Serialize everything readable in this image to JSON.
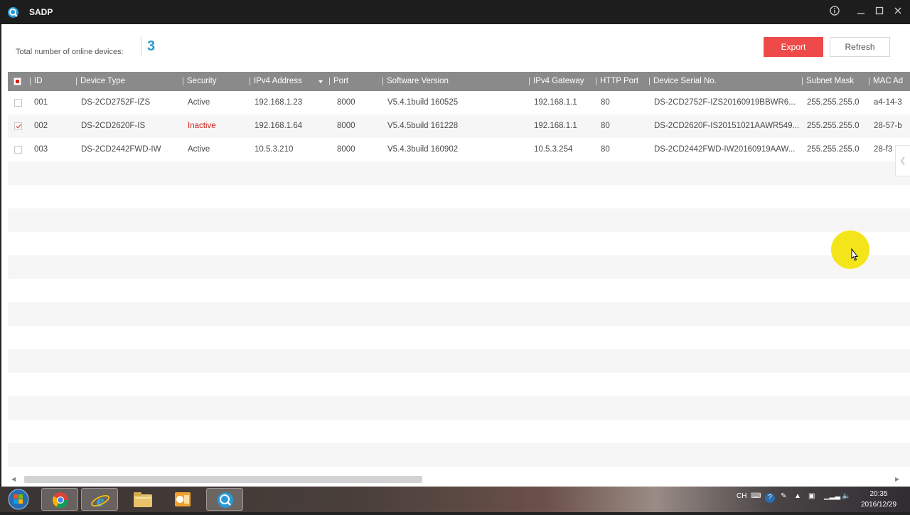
{
  "window": {
    "title": "SADP"
  },
  "summary": {
    "label": "Total number of online devices:",
    "count": "3"
  },
  "buttons": {
    "export": "Export",
    "refresh": "Refresh"
  },
  "columns": {
    "id": "ID",
    "device_type": "Device Type",
    "security": "Security",
    "ipv4_address": "IPv4 Address",
    "port": "Port",
    "software_version": "Software Version",
    "ipv4_gateway": "IPv4 Gateway",
    "http_port": "HTTP Port",
    "serial": "Device Serial No.",
    "subnet_mask": "Subnet Mask",
    "mac": "MAC Ad"
  },
  "rows": [
    {
      "checked": false,
      "id": "001",
      "device_type": "DS-2CD2752F-IZS",
      "security": "Active",
      "ipv4_address": "192.168.1.23",
      "port": "8000",
      "software_version": "V5.4.1build 160525",
      "ipv4_gateway": "192.168.1.1",
      "http_port": "80",
      "serial": "DS-2CD2752F-IZS20160919BBWR6...",
      "subnet_mask": "255.255.255.0",
      "mac": "a4-14-3"
    },
    {
      "checked": true,
      "id": "002",
      "device_type": "DS-2CD2620F-IS",
      "security": "Inactive",
      "ipv4_address": "192.168.1.64",
      "port": "8000",
      "software_version": "V5.4.5build 161228",
      "ipv4_gateway": "192.168.1.1",
      "http_port": "80",
      "serial": "DS-2CD2620F-IS20151021AAWR549...",
      "subnet_mask": "255.255.255.0",
      "mac": "28-57-b"
    },
    {
      "checked": false,
      "id": "003",
      "device_type": "DS-2CD2442FWD-IW",
      "security": "Active",
      "ipv4_address": "10.5.3.210",
      "port": "8000",
      "software_version": "V5.4.3build 160902",
      "ipv4_gateway": "10.5.3.254",
      "http_port": "80",
      "serial": "DS-2CD2442FWD-IW20160919AAW...",
      "subnet_mask": "255.255.255.0",
      "mac": "28-f3"
    }
  ],
  "colors": {
    "accent": "#2a9ad6",
    "export": "#ef4a4a",
    "inactive": "#d2231b",
    "header": "#8a8a8a"
  },
  "taskbar": {
    "apps": [
      "start-orb-icon",
      "chrome-icon",
      "internet-explorer-icon",
      "file-explorer-icon",
      "outlook-icon",
      "sadp-icon"
    ],
    "tray": {
      "lang": "CH"
    },
    "clock": {
      "time": "20:35",
      "date": "2016/12/29"
    }
  }
}
